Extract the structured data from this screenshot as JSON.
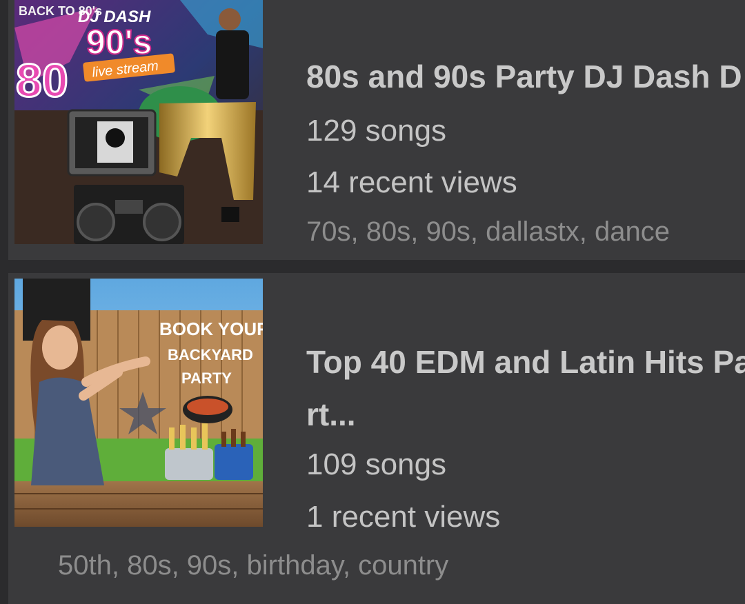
{
  "playlists": [
    {
      "title": "80s and 90s Party DJ Dash D",
      "songs": "129 songs",
      "views": "14 recent views",
      "tags": "70s, 80s, 90s, dallastx, dance",
      "artwork": {
        "top_text": "BACK TO 80's",
        "dj_name": "DJ DASH",
        "decade": "90's",
        "badge": "live stream",
        "big_text": "80"
      }
    },
    {
      "title_line1": "Top 40 EDM and Latin Hits Pa",
      "title_line2": "rt...",
      "songs": "109 songs",
      "views": "1 recent views",
      "tags": "50th, 80s, 90s, birthday, country",
      "artwork": {
        "line1": "BOOK YOUR",
        "line2": "BACKYARD",
        "line3": "PARTY"
      }
    }
  ],
  "colors": {
    "page_bg": "#2b2b2d",
    "card_bg": "#3a3a3c",
    "title": "#c9c9c9",
    "tags": "#8d8d8d"
  }
}
